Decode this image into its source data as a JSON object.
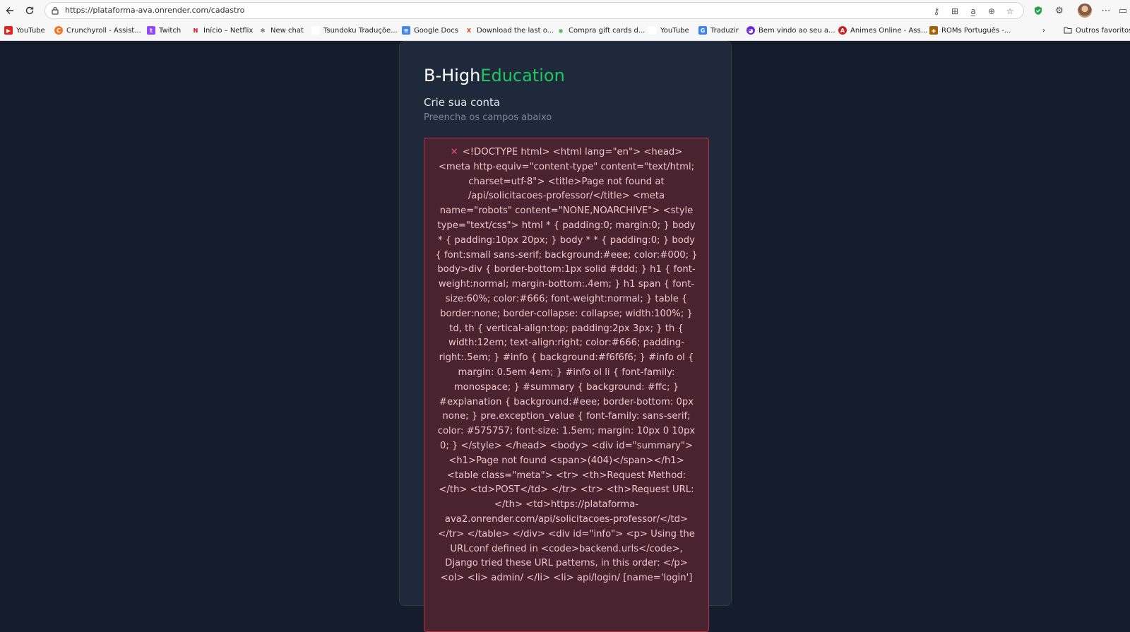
{
  "browser": {
    "url": "https://plataforma-ava.onrender.com/cadastro",
    "bookmarks": [
      {
        "label": "YouTube",
        "icon": "youtube-icon",
        "color": "#e62117",
        "glyph": "▶"
      },
      {
        "label": "Crunchyroll - Assist...",
        "icon": "crunchyroll-icon",
        "color": "#f47521",
        "glyph": "C"
      },
      {
        "label": "Twitch",
        "icon": "twitch-icon",
        "color": "#9146ff",
        "glyph": "t"
      },
      {
        "label": "Início – Netflix",
        "icon": "netflix-icon",
        "color": "#e50914",
        "glyph": "N"
      },
      {
        "label": "New chat",
        "icon": "openai-icon",
        "color": "#444444",
        "glyph": "✻"
      },
      {
        "label": "Tsundoku Traduçõe...",
        "icon": "tsundoku-icon",
        "color": "#ffffff",
        "glyph": ""
      },
      {
        "label": "Google Docs",
        "icon": "google-docs-icon",
        "color": "#4285f4",
        "glyph": "≡"
      },
      {
        "label": "Download the last o...",
        "icon": "x-icon",
        "color": "#d9442a",
        "glyph": "X"
      },
      {
        "label": "Compra gift cards d...",
        "icon": "chrome-icon",
        "color": "#4caf50",
        "glyph": "◉"
      },
      {
        "label": "YouTube",
        "icon": "youtube-blank-icon",
        "color": "#ffffff",
        "glyph": ""
      },
      {
        "label": "Traduzir",
        "icon": "translate-icon",
        "color": "#3b82f6",
        "glyph": "G"
      },
      {
        "label": "Bem vindo ao seu a...",
        "icon": "chat-icon",
        "color": "#6d28d9",
        "glyph": "◕"
      },
      {
        "label": "Animes Online - Ass...",
        "icon": "anime-icon",
        "color": "#c81e1e",
        "glyph": "A"
      },
      {
        "label": "ROMs Português -...",
        "icon": "roms-icon",
        "color": "#a16207",
        "glyph": "◈"
      }
    ],
    "other_favorites": "Outros favoritos"
  },
  "brand": {
    "prefix": "B-High",
    "accent": "Education"
  },
  "form": {
    "title": "Crie sua conta",
    "subtitle": "Preencha os campos abaixo"
  },
  "error": {
    "icon": "✕",
    "message": "<!DOCTYPE html> <html lang=\"en\"> <head> <meta http-equiv=\"content-type\" content=\"text/html; charset=utf-8\"> <title>Page not found at /api/solicitacoes-professor/</title> <meta name=\"robots\" content=\"NONE,NOARCHIVE\"> <style type=\"text/css\"> html * { padding:0; margin:0; } body * { padding:10px 20px; } body * * { padding:0; } body { font:small sans-serif; background:#eee; color:#000; } body>div { border-bottom:1px solid #ddd; } h1 { font-weight:normal; margin-bottom:.4em; } h1 span { font-size:60%; color:#666; font-weight:normal; } table { border:none; border-collapse: collapse; width:100%; } td, th { vertical-align:top; padding:2px 3px; } th { width:12em; text-align:right; color:#666; padding-right:.5em; } #info { background:#f6f6f6; } #info ol { margin: 0.5em 4em; } #info ol li { font-family: monospace; } #summary { background: #ffc; } #explanation { background:#eee; border-bottom: 0px none; } pre.exception_value { font-family: sans-serif; color: #575757; font-size: 1.5em; margin: 10px 0 10px 0; } </style> </head> <body> <div id=\"summary\"> <h1>Page not found <span>(404)</span></h1> <table class=\"meta\"> <tr> <th>Request Method:</th> <td>POST</td> </tr> <tr> <th>Request URL:</th> <td>https://plataforma-ava2.onrender.com/api/solicitacoes-professor/</td> </tr> </table> </div> <div id=\"info\"> <p> Using the URLconf defined in <code>backend.urls</code>, Django tried these URL patterns, in this order: </p> <ol> <li> admin/ </li> <li> api/login/ [name='login']"
  },
  "colors": {
    "page_bg": "#151c2c",
    "card_bg": "#1e293b",
    "accent": "#22c55e",
    "error_bg": "#4a2330",
    "error_border": "#b23444"
  }
}
